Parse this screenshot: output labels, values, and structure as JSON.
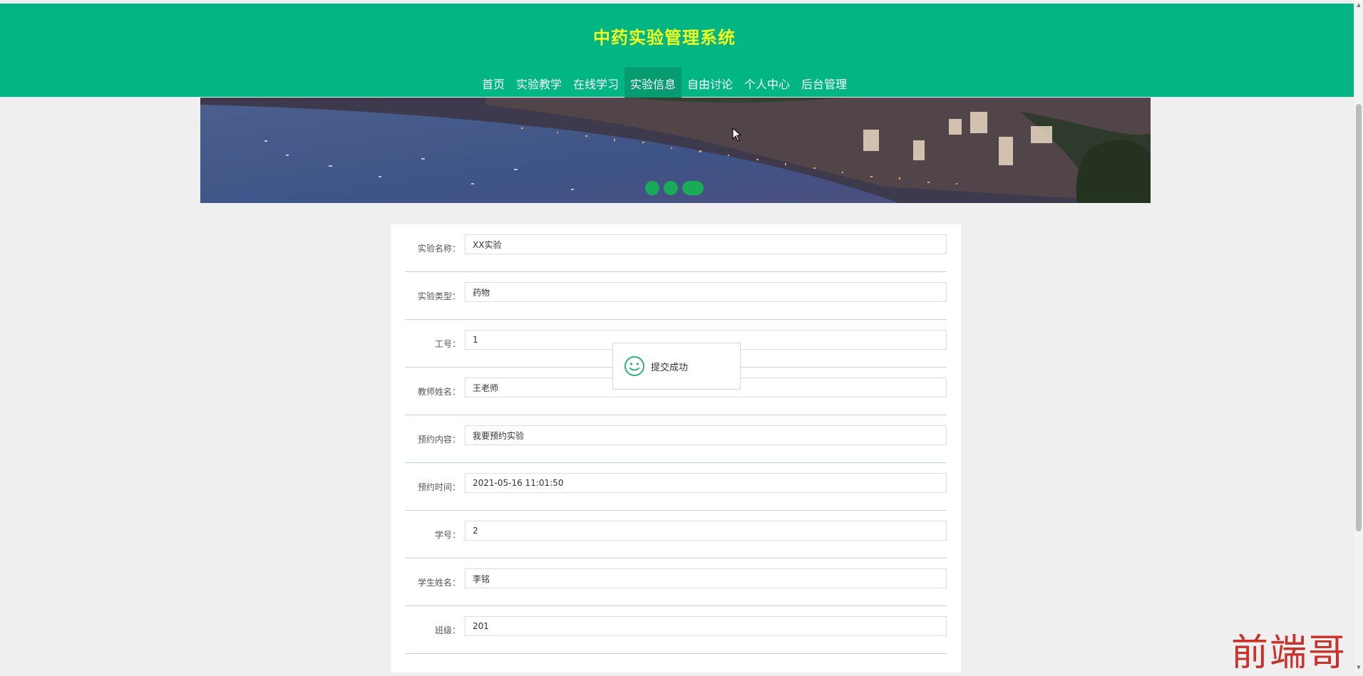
{
  "header": {
    "title": "中药实验管理系统"
  },
  "nav": {
    "items": [
      "首页",
      "实验教学",
      "在线学习",
      "实验信息",
      "自由讨论",
      "个人中心",
      "后台管理"
    ],
    "active_index": 3
  },
  "banner": {
    "slide_count": 3,
    "active_slide": 3
  },
  "form": {
    "fields": [
      {
        "label": "实验名称：",
        "value": "XX实验"
      },
      {
        "label": "实验类型：",
        "value": "药物"
      },
      {
        "label": "工号：",
        "value": "1"
      },
      {
        "label": "教师姓名：",
        "value": "王老师"
      },
      {
        "label": "预约内容：",
        "value": "我要预约实验"
      },
      {
        "label": "预约时间：",
        "value": "2021-05-16 11:01:50"
      },
      {
        "label": "学号：",
        "value": "2"
      },
      {
        "label": "学生姓名：",
        "value": "李铭"
      },
      {
        "label": "班级：",
        "value": "201"
      }
    ]
  },
  "toast": {
    "icon": "smile-icon",
    "message": "提交成功"
  },
  "watermark": {
    "text": "前端哥"
  },
  "colors": {
    "header_bg": "#02b683",
    "title": "#f0ff21",
    "nav_active": "#079c70",
    "slider_dot": "#1aab59",
    "toast_icon": "#2fb27a",
    "watermark": "#c8322a"
  }
}
